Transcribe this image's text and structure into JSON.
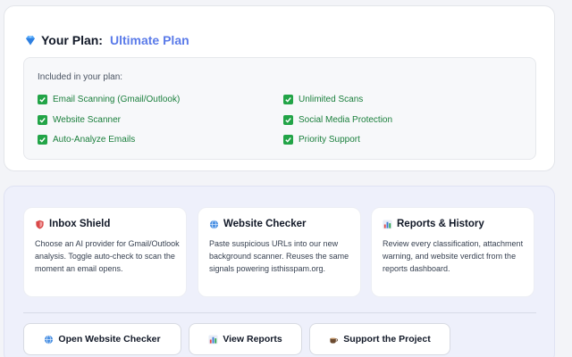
{
  "plan": {
    "label": "Your Plan:",
    "name": "Ultimate Plan",
    "included_heading": "Included in your plan:",
    "features_left": [
      "Email Scanning (Gmail/Outlook)",
      "Website Scanner",
      "Auto-Analyze Emails"
    ],
    "features_right": [
      "Unlimited Scans",
      "Social Media Protection",
      "Priority Support"
    ],
    "icon": "gem-icon"
  },
  "cards": [
    {
      "title": "Inbox Shield",
      "icon": "shield-icon",
      "body": "Choose an AI provider for Gmail/Outlook analysis. Toggle auto-check to scan the moment an email opens."
    },
    {
      "title": "Website Checker",
      "icon": "globe-icon",
      "body": "Paste suspicious URLs into our new background scanner. Reuses the same signals powering isthisspam.org."
    },
    {
      "title": "Reports & History",
      "icon": "bar-chart-icon",
      "body": "Review every classification, attachment warning, and website verdict from the reports dashboard."
    }
  ],
  "buttons": [
    {
      "label": "Open Website Checker",
      "icon": "globe-icon"
    },
    {
      "label": "View Reports",
      "icon": "bar-chart-icon"
    },
    {
      "label": "Support the Project",
      "icon": "coffee-icon"
    }
  ],
  "colors": {
    "accent": "#5b7be9",
    "success": "#1a7f3c",
    "check_bg": "#22a447"
  }
}
